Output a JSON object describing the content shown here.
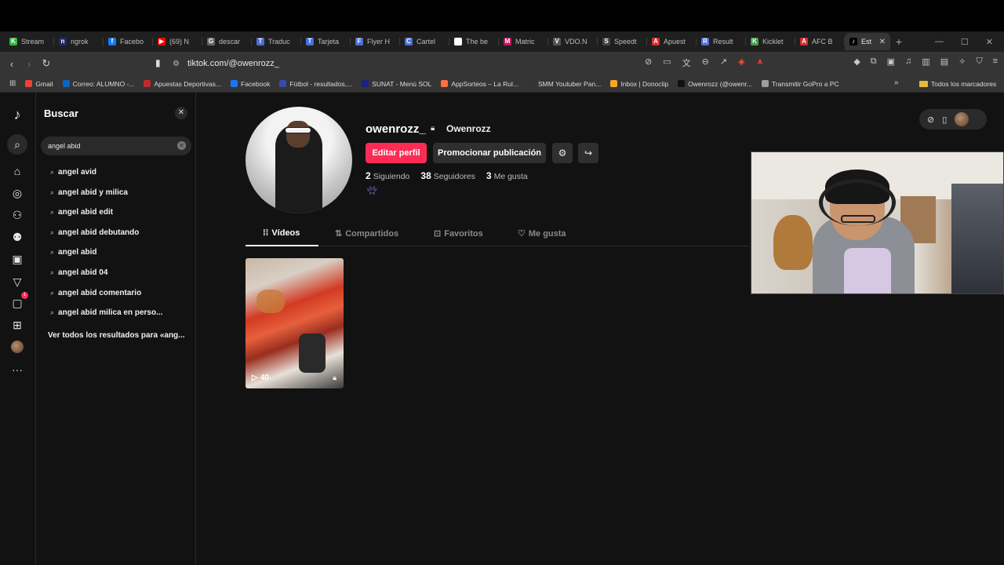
{
  "browser": {
    "tabs": [
      {
        "label": "Stream",
        "color": "#2fb83a",
        "glyph": "K"
      },
      {
        "label": "ngrok",
        "color": "#1f2a6d",
        "glyph": "n"
      },
      {
        "label": "Facebo",
        "color": "#1877f2",
        "glyph": "f"
      },
      {
        "label": "(69) N",
        "color": "#ff0000",
        "glyph": "▶"
      },
      {
        "label": "descar",
        "color": "#666666",
        "glyph": "G"
      },
      {
        "label": "Traduc",
        "color": "#4a6fd8",
        "glyph": "T"
      },
      {
        "label": "Tarjeta",
        "color": "#4a6fd8",
        "glyph": "T"
      },
      {
        "label": "Flyer H",
        "color": "#4a6fd8",
        "glyph": "F"
      },
      {
        "label": "Cartel",
        "color": "#4a6fd8",
        "glyph": "C"
      },
      {
        "label": "The be",
        "color": "#ffffff",
        "glyph": "◆"
      },
      {
        "label": "Matric",
        "color": "#c2185b",
        "glyph": "M"
      },
      {
        "label": "VDO.N",
        "color": "#555555",
        "glyph": "V"
      },
      {
        "label": "Speedt",
        "color": "#444444",
        "glyph": "S"
      },
      {
        "label": "Apuest",
        "color": "#d32f2f",
        "glyph": "A"
      },
      {
        "label": "Result",
        "color": "#4a6fd8",
        "glyph": "R"
      },
      {
        "label": "Kicklet",
        "color": "#43a047",
        "glyph": "K"
      },
      {
        "label": "AFC B",
        "color": "#d32f2f",
        "glyph": "A"
      }
    ],
    "active_tab": {
      "label": "Est",
      "glyph": "♪"
    },
    "new_tab": "+",
    "url": "tiktok.com/@owenrozz_",
    "bookmarks": [
      {
        "label": "Gmail",
        "color": "#ea4335"
      },
      {
        "label": "Correo: ALUMNO -...",
        "color": "#0a66c2"
      },
      {
        "label": "Apuestas Deportivas...",
        "color": "#c62828"
      },
      {
        "label": "Facebook",
        "color": "#1877f2"
      },
      {
        "label": "Fútbol - resultados,...",
        "color": "#3949ab"
      },
      {
        "label": "SUNAT - Menú SOL",
        "color": "#1a237e"
      },
      {
        "label": "AppSorteos – La Rul...",
        "color": "#ff7043"
      },
      {
        "label": "SMM Youtuber Pan...",
        "color": "#333333"
      },
      {
        "label": "Inbox | Donoclip",
        "color": "#f9a825"
      },
      {
        "label": "Owenrozz (@owenr...",
        "color": "#111111"
      },
      {
        "label": "Transmitir GoPro a PC",
        "color": "#9e9e9e"
      }
    ],
    "bookmarks_folder": "Todos los marcadores"
  },
  "search": {
    "title": "Buscar",
    "query": "angel abid",
    "suggestions": [
      "angel avid",
      "angel abid y milica",
      "angel abid edit",
      "angel abid debutando",
      "angel abid",
      "angel abid 04",
      "angel abid comentario",
      "angel abid milica en perso..."
    ],
    "see_all": "Ver todos los resultados para «ang..."
  },
  "rail": {
    "inbox_badge": "1"
  },
  "profile": {
    "username": "owenrozz_",
    "display_name": "Owenrozz",
    "edit_label": "Editar perfil",
    "promote_label": "Promocionar publicación",
    "following_count": "2",
    "following_label": "Siguiendo",
    "followers_count": "38",
    "followers_label": "Seguidores",
    "likes_count": "3",
    "likes_label": "Me gusta"
  },
  "profile_tabs": [
    {
      "label": "Vídeos",
      "icon": "grid-icon"
    },
    {
      "label": "Compartidos",
      "icon": "repost-icon"
    },
    {
      "label": "Favoritos",
      "icon": "bookmark-icon"
    },
    {
      "label": "Me gusta",
      "icon": "heart-icon"
    }
  ],
  "videos": [
    {
      "plays": "40",
      "private": true
    }
  ],
  "colors": {
    "accent": "#fe2c55",
    "page_bg": "#121212"
  }
}
